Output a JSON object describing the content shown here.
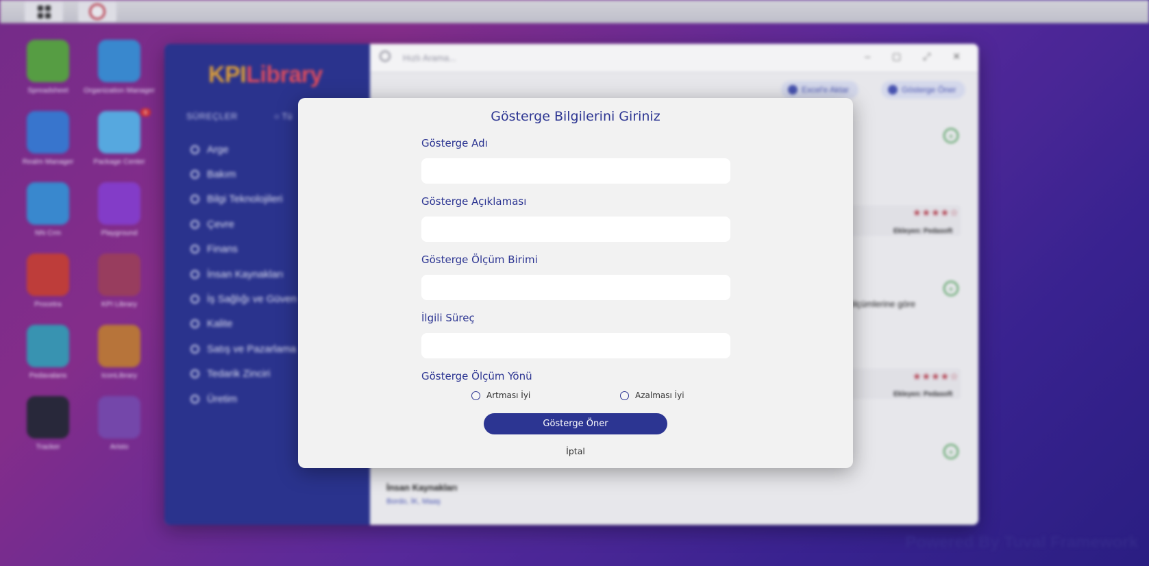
{
  "desktop": {
    "icons": [
      {
        "label": "Spreadsheet",
        "icon": "spreadsheet-icon",
        "color": "#5aa544"
      },
      {
        "label": "Organization Manager",
        "icon": "org-manager-icon",
        "color": "#3b8fd6"
      },
      {
        "label": "Realm Manager",
        "icon": "realm-manager-icon",
        "color": "#3a7bd5"
      },
      {
        "label": "Package Center",
        "icon": "package-center-icon",
        "color": "#5ab0e8"
      },
      {
        "label": "NN Crm",
        "icon": "crm-icon",
        "color": "#3b8fd6"
      },
      {
        "label": "Playground",
        "icon": "playground-icon",
        "color": "#8a3fd0"
      },
      {
        "label": "Procetra",
        "icon": "procetra-icon",
        "color": "#c8403a"
      },
      {
        "label": "KPI Library",
        "icon": "kpi-library-icon",
        "color": "#a04060"
      },
      {
        "label": "Pedavalans",
        "icon": "pedavalans-icon",
        "color": "#3a9ab8"
      },
      {
        "label": "IconLibrary",
        "icon": "icon-library-icon",
        "color": "#c07a3a"
      },
      {
        "label": "Tracker",
        "icon": "tracker-icon",
        "color": "#2a2a3a"
      },
      {
        "label": "Aristo",
        "icon": "aristo-icon",
        "color": "#7a4ab0"
      }
    ],
    "package_badge": "6",
    "powered_by": "Powered By Tuval Framework"
  },
  "app": {
    "logo_part1": "KPI",
    "logo_part2": "Library",
    "side_heading": "SÜREÇLER",
    "side_heading2": "Tü",
    "processes": [
      "Arge",
      "Bakım",
      "Bilgi Teknolojileri",
      "Çevre",
      "Finans",
      "İnsan Kaynakları",
      "İş Sağlığı ve Güven",
      "Kalite",
      "Satış ve Pazarlama",
      "Tedarik Zinciri",
      "Üretim"
    ],
    "search_placeholder": "Hızlı Arama...",
    "excel_button": "Excel'e Aktar",
    "suggest_button": "Gösterge Öner",
    "ekleyen": "Ekleyen: Pedasoft",
    "bg_text_1": "ölçümlerine göre",
    "bg_category": "İnsan Kaynakları",
    "bg_tags": "Bordo, İK, Maaş"
  },
  "modal": {
    "title": "Gösterge Bilgilerini Giriniz",
    "name_label": "Gösterge Adı",
    "name_value": "",
    "desc_label": "Gösterge Açıklaması",
    "desc_value": "",
    "unit_label": "Gösterge Ölçüm Birimi",
    "unit_value": "",
    "process_label": "İlgili Süreç",
    "process_value": "",
    "direction_label": "Gösterge Ölçüm Yönü",
    "option_increase": "Artması İyi",
    "option_decrease": "Azalması İyi",
    "submit_label": "Gösterge Öner",
    "cancel_label": "İptal"
  },
  "colors": {
    "primary": "#2c3592",
    "accent_gold": "#e5a53b",
    "accent_red": "#e84f5f",
    "success": "#3e9a4a"
  }
}
